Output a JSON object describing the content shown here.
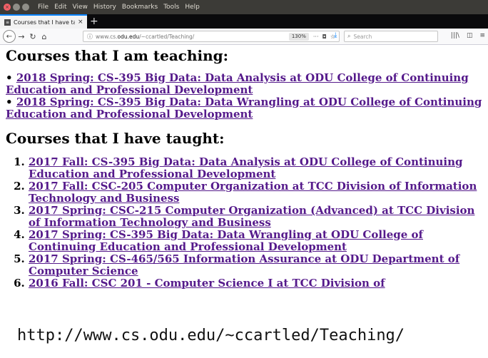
{
  "menubar": {
    "items": [
      "File",
      "Edit",
      "View",
      "History",
      "Bookmarks",
      "Tools",
      "Help"
    ]
  },
  "tab": {
    "title": "Courses that I have taug",
    "close": "×"
  },
  "newtab": "+",
  "address": {
    "prefix": "www.cs.",
    "domain": "odu.edu",
    "path": "/~ccartled/Teaching/",
    "zoom": "130%"
  },
  "search": {
    "placeholder": "Search"
  },
  "page": {
    "heading_teaching": "Courses that I am teaching:",
    "teaching": [
      "2018 Spring: CS-395 Big Data: Data Analysis at ODU College of Continuing Education and Professional Development",
      "2018 Spring: CS-395 Big Data: Data Wrangling at ODU College of Continuing Education and Professional Development"
    ],
    "heading_taught": "Courses that I have taught:",
    "taught": [
      "2017 Fall: CS-395 Big Data: Data Analysis at ODU College of Continuing Education and Professional Development",
      "2017 Fall: CSC-205 Computer Organization at TCC Division of Information Technology and Business",
      "2017 Spring: CSC-215 Computer Organization (Advanced) at TCC Division of Information Technology and Business",
      "2017 Spring: CS-395 Big Data: Data Wrangling at ODU College of Continuing Education and Professional Development",
      "2017 Spring: CS-465/565 Information Assurance at ODU Department of Computer Science",
      "2016 Fall: CSC 201 - Computer Science I at TCC Division of"
    ]
  },
  "footer_url": "http://www.cs.odu.edu/~ccartled/Teaching/"
}
